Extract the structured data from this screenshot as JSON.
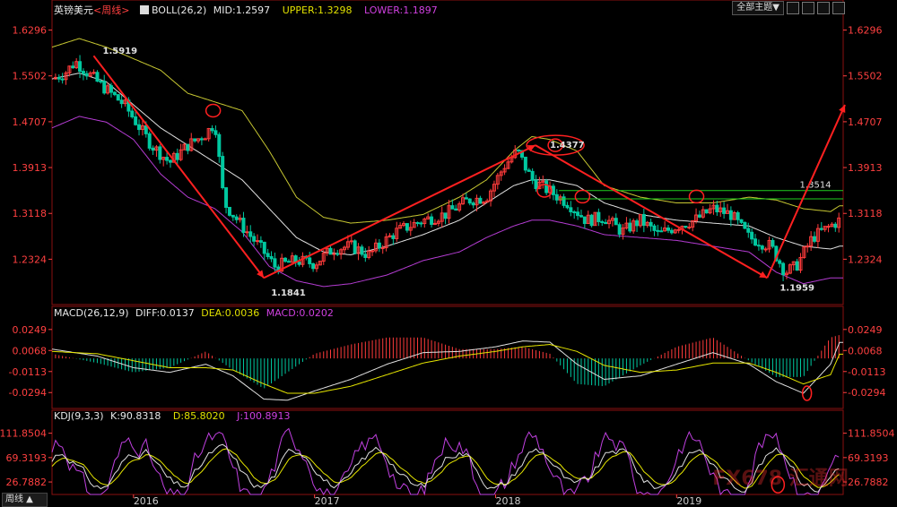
{
  "header": {
    "symbol": "英镑美元",
    "period_tag": "<周线>",
    "boll_name": "BOLL(26,2)",
    "boll_mid": "MID:1.2597",
    "boll_upper": "UPPER:1.3298",
    "boll_lower": "LOWER:1.1897",
    "macd_name": "MACD(26,12,9)",
    "macd_diff": "DIFF:0.0137",
    "macd_dea": "DEA:0.0036",
    "macd_macd": "MACD:0.0202",
    "kdj_name": "KDJ(9,3,3)",
    "kdj_k": "K:90.8318",
    "kdj_d": "D:85.8020",
    "kdj_j": "J:100.8913"
  },
  "toolbar": {
    "theme_label": "全部主题▼"
  },
  "period_selector": {
    "label": "周线 ▲"
  },
  "watermark": {
    "text": "FX678 汇通网"
  },
  "colors": {
    "up": "#ff3b3b",
    "down": "#00c8a0",
    "upper": "#c8c832",
    "mid": "#e0e0e0",
    "lower": "#b43cd2",
    "annotation": "#ff2020",
    "hline": "#20d020",
    "tick": "#ff4040",
    "diff": "#e0e0e0",
    "dea": "#e6e600",
    "kdj_j": "#c040e0"
  },
  "chart_data": [
    {
      "type": "candlestick",
      "name": "price",
      "y_ticks": [
        "1.6296",
        "1.5502",
        "1.4707",
        "1.3913",
        "1.3118",
        "1.2324"
      ],
      "y_tick_values": [
        1.6296,
        1.5502,
        1.4707,
        1.3913,
        1.3118,
        1.2324
      ],
      "ylim": [
        1.16,
        1.66
      ],
      "x_range": [
        2015.55,
        2019.92
      ],
      "x_ticks": [
        "2016",
        "2017",
        "2018",
        "2019"
      ],
      "x_tick_values": [
        2016,
        2017,
        2018,
        2019
      ],
      "anchors": {
        "x": [
          2015.55,
          2015.62,
          2015.68,
          2015.8,
          2015.95,
          2016.1,
          2016.2,
          2016.3,
          2016.4,
          2016.45,
          2016.5,
          2016.6,
          2016.72,
          2016.78,
          2016.9,
          2017.0,
          2017.1,
          2017.2,
          2017.3,
          2017.45,
          2017.6,
          2017.72,
          2017.85,
          2017.95,
          2018.05,
          2018.12,
          2018.2,
          2018.3,
          2018.4,
          2018.5,
          2018.6,
          2018.7,
          2018.8,
          2018.9,
          2019.0,
          2019.1,
          2019.2,
          2019.3,
          2019.4,
          2019.52,
          2019.6,
          2019.66,
          2019.75,
          2019.85,
          2019.9
        ],
        "close": [
          1.545,
          1.555,
          1.575,
          1.54,
          1.5,
          1.43,
          1.4,
          1.43,
          1.45,
          1.47,
          1.33,
          1.29,
          1.245,
          1.22,
          1.23,
          1.225,
          1.25,
          1.255,
          1.24,
          1.28,
          1.3,
          1.31,
          1.335,
          1.34,
          1.395,
          1.42,
          1.37,
          1.35,
          1.33,
          1.3,
          1.305,
          1.28,
          1.3,
          1.275,
          1.29,
          1.3,
          1.32,
          1.31,
          1.27,
          1.255,
          1.21,
          1.22,
          1.27,
          1.29,
          1.3
        ]
      },
      "bollinger": {
        "upper": {
          "x": [
            2015.55,
            2015.7,
            2015.85,
            2016.0,
            2016.15,
            2016.3,
            2016.45,
            2016.6,
            2016.75,
            2016.9,
            2017.05,
            2017.2,
            2017.4,
            2017.6,
            2017.8,
            2017.95,
            2018.1,
            2018.2,
            2018.3,
            2018.45,
            2018.6,
            2018.8,
            2019.0,
            2019.2,
            2019.4,
            2019.55,
            2019.7,
            2019.85,
            2019.9
          ],
          "y": [
            1.6,
            1.615,
            1.6,
            1.58,
            1.56,
            1.52,
            1.505,
            1.49,
            1.42,
            1.34,
            1.305,
            1.295,
            1.3,
            1.31,
            1.34,
            1.37,
            1.42,
            1.445,
            1.44,
            1.42,
            1.36,
            1.34,
            1.33,
            1.33,
            1.34,
            1.335,
            1.32,
            1.315,
            1.325
          ]
        },
        "mid": {
          "x": [
            2015.55,
            2015.7,
            2015.85,
            2016.0,
            2016.15,
            2016.3,
            2016.45,
            2016.6,
            2016.75,
            2016.9,
            2017.05,
            2017.2,
            2017.4,
            2017.6,
            2017.8,
            2017.95,
            2018.1,
            2018.2,
            2018.3,
            2018.45,
            2018.6,
            2018.8,
            2019.0,
            2019.2,
            2019.4,
            2019.55,
            2019.7,
            2019.85,
            2019.9
          ],
          "y": [
            1.545,
            1.555,
            1.54,
            1.5,
            1.46,
            1.43,
            1.4,
            1.37,
            1.32,
            1.27,
            1.245,
            1.24,
            1.255,
            1.275,
            1.3,
            1.33,
            1.36,
            1.37,
            1.37,
            1.36,
            1.33,
            1.31,
            1.3,
            1.295,
            1.29,
            1.27,
            1.255,
            1.25,
            1.255
          ]
        },
        "lower": {
          "x": [
            2015.55,
            2015.7,
            2015.85,
            2016.0,
            2016.15,
            2016.3,
            2016.45,
            2016.6,
            2016.75,
            2016.9,
            2017.05,
            2017.2,
            2017.4,
            2017.6,
            2017.8,
            2017.95,
            2018.1,
            2018.2,
            2018.3,
            2018.45,
            2018.6,
            2018.8,
            2019.0,
            2019.2,
            2019.4,
            2019.55,
            2019.7,
            2019.85,
            2019.9
          ],
          "y": [
            1.46,
            1.48,
            1.47,
            1.44,
            1.38,
            1.34,
            1.32,
            1.28,
            1.22,
            1.195,
            1.185,
            1.19,
            1.205,
            1.23,
            1.245,
            1.27,
            1.29,
            1.3,
            1.3,
            1.29,
            1.275,
            1.27,
            1.265,
            1.255,
            1.245,
            1.21,
            1.19,
            1.2,
            1.2
          ]
        }
      },
      "hlines": [
        {
          "y": 1.3514,
          "from_x": 2018.35,
          "to_x": 2019.92,
          "label": "1.3514"
        },
        {
          "y": 1.337,
          "from_x": 2018.35,
          "to_x": 2019.92
        }
      ],
      "arrows": [
        {
          "x": [
            2015.78,
            2016.72
          ],
          "y": [
            1.585,
            1.2
          ]
        },
        {
          "x": [
            2016.72,
            2018.22
          ],
          "y": [
            1.2,
            1.43
          ]
        },
        {
          "x": [
            2018.22,
            2019.5
          ],
          "y": [
            1.43,
            1.2
          ]
        },
        {
          "x": [
            2019.5,
            2019.93
          ],
          "y": [
            1.2,
            1.5
          ]
        }
      ],
      "price_labels": [
        {
          "text": "1.5919",
          "x": 2015.83,
          "y": 1.593
        },
        {
          "text": "1.1841",
          "x": 2016.76,
          "y": 1.185
        },
        {
          "text": "1.4377",
          "x": 2018.3,
          "y": 1.43
        },
        {
          "text": "1.1959",
          "x": 2019.57,
          "y": 1.193
        }
      ],
      "circles": [
        {
          "x": 2016.44,
          "y": 1.49
        },
        {
          "x": 2018.33,
          "y": 1.43
        },
        {
          "x": 2018.27,
          "y": 1.351
        },
        {
          "x": 2018.48,
          "y": 1.341
        },
        {
          "x": 2019.11,
          "y": 1.341
        }
      ]
    },
    {
      "type": "macd",
      "name": "MACD",
      "y_ticks": [
        "0.0249",
        "0.0068",
        "-0.0113",
        "-0.0294"
      ],
      "y_tick_values": [
        0.0249,
        0.0068,
        -0.0113,
        -0.0294
      ],
      "ylim": [
        -0.04,
        0.034
      ],
      "diff": {
        "x": [
          2015.55,
          2015.8,
          2016.0,
          2016.2,
          2016.4,
          2016.55,
          2016.72,
          2016.85,
          2017.0,
          2017.2,
          2017.4,
          2017.6,
          2017.8,
          2018.0,
          2018.15,
          2018.3,
          2018.45,
          2018.6,
          2018.8,
          2019.0,
          2019.2,
          2019.4,
          2019.55,
          2019.7,
          2019.85,
          2019.9
        ],
        "y": [
          0.008,
          0.002,
          -0.008,
          -0.012,
          -0.005,
          -0.015,
          -0.035,
          -0.036,
          -0.028,
          -0.018,
          -0.005,
          0.005,
          0.006,
          0.01,
          0.015,
          0.014,
          -0.005,
          -0.018,
          -0.015,
          -0.005,
          0.005,
          -0.005,
          -0.02,
          -0.03,
          -0.005,
          0.0137
        ]
      },
      "dea": {
        "x": [
          2015.55,
          2015.8,
          2016.0,
          2016.2,
          2016.4,
          2016.55,
          2016.72,
          2016.85,
          2017.0,
          2017.2,
          2017.4,
          2017.6,
          2017.8,
          2018.0,
          2018.15,
          2018.3,
          2018.45,
          2018.6,
          2018.8,
          2019.0,
          2019.2,
          2019.4,
          2019.55,
          2019.7,
          2019.85,
          2019.9
        ],
        "y": [
          0.006,
          0.004,
          -0.002,
          -0.008,
          -0.008,
          -0.01,
          -0.022,
          -0.03,
          -0.03,
          -0.024,
          -0.014,
          -0.004,
          0.002,
          0.006,
          0.01,
          0.012,
          0.006,
          -0.006,
          -0.012,
          -0.01,
          -0.004,
          -0.004,
          -0.012,
          -0.022,
          -0.014,
          0.0036
        ]
      }
    },
    {
      "type": "kdj",
      "name": "KDJ",
      "y_ticks": [
        "111.8504",
        "69.3193",
        "26.7882"
      ],
      "y_tick_values": [
        111.8504,
        69.3193,
        26.7882
      ],
      "ylim": [
        5,
        130
      ],
      "last": {
        "k": 90.8318,
        "d": 85.802,
        "j": 100.8913
      }
    }
  ]
}
